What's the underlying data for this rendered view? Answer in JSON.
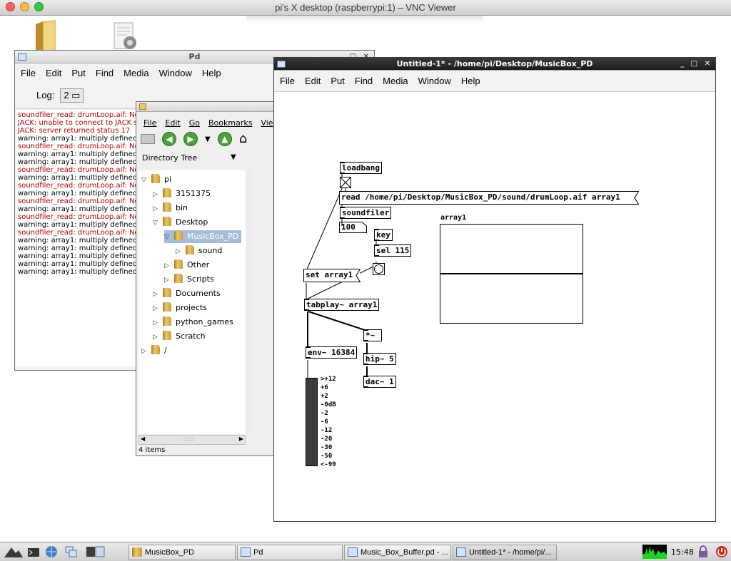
{
  "vnc": {
    "title": "pi's X desktop (raspberrypi:1) – VNC Viewer"
  },
  "pd_main": {
    "title": "Pd",
    "menu": [
      "File",
      "Edit",
      "Put",
      "Find",
      "Media",
      "Window",
      "Help"
    ],
    "log_label": "Log:",
    "log_level": "2",
    "log_lines": [
      {
        "text": "soundfiler_read: drumLoop.aif: No",
        "error": true
      },
      {
        "text": "JACK: unable to connect to JACK s",
        "error": true
      },
      {
        "text": "JACK: server returned status 17",
        "error": true
      },
      {
        "text": "warning: array1: multiply defined",
        "error": false
      },
      {
        "text": "soundfiler_read: drumLoop.aif: No",
        "error": true
      },
      {
        "text": "warning: array1: multiply defined",
        "error": false
      },
      {
        "text": "warning: array1: multiply defined",
        "error": false
      },
      {
        "text": "soundfiler_read: drumLoop.aif: No",
        "error": true
      },
      {
        "text": "warning: array1: multiply defined",
        "error": false
      },
      {
        "text": "soundfiler_read: drumLoop.aif: No",
        "error": true
      },
      {
        "text": "warning: array1: multiply defined",
        "error": false
      },
      {
        "text": "soundfiler_read: drumLoop.aif: No",
        "error": true
      },
      {
        "text": "warning: array1: multiply defined",
        "error": false
      },
      {
        "text": "soundfiler_read: drumLoop.aif: No",
        "error": true
      },
      {
        "text": "warning: array1: multiply defined",
        "error": false
      },
      {
        "text": "soundfiler_read: drumLoop.aif: No",
        "error": true
      },
      {
        "text": "warning: array1: multiply defined",
        "error": false
      },
      {
        "text": "warning: array1: multiply defined",
        "error": false
      },
      {
        "text": "warning: array1: multiply defined",
        "error": false
      },
      {
        "text": "warning: array1: multiply defined",
        "error": false
      },
      {
        "text": "warning: array1: multiply defined",
        "error": false
      }
    ]
  },
  "file_manager": {
    "menu": [
      "File",
      "Edit",
      "Go",
      "Bookmarks",
      "Vie"
    ],
    "sidepane_label": "Directory Tree",
    "tree": [
      {
        "label": "pi",
        "level": 0,
        "expanded": true
      },
      {
        "label": "3151375",
        "level": 1,
        "expanded": false
      },
      {
        "label": "bin",
        "level": 1,
        "expanded": false
      },
      {
        "label": "Desktop",
        "level": 1,
        "expanded": true
      },
      {
        "label": "MusicBox_PD",
        "level": 2,
        "expanded": true,
        "selected": true
      },
      {
        "label": "sound",
        "level": 3,
        "expanded": false
      },
      {
        "label": "Other",
        "level": 2,
        "expanded": false
      },
      {
        "label": "Scripts",
        "level": 2,
        "expanded": false
      },
      {
        "label": "Documents",
        "level": 1,
        "expanded": false
      },
      {
        "label": "projects",
        "level": 1,
        "expanded": false
      },
      {
        "label": "python_games",
        "level": 1,
        "expanded": false
      },
      {
        "label": "Scratch",
        "level": 1,
        "expanded": false
      },
      {
        "label": "/",
        "level": 0,
        "expanded": false
      }
    ],
    "status": "4 items"
  },
  "patch": {
    "title": "Untitled-1* - /home/pi/Desktop/MusicBox_PD",
    "menu": [
      "File",
      "Edit",
      "Put",
      "Find",
      "Media",
      "Window",
      "Help"
    ],
    "objects": {
      "loadbang": "loadbang",
      "read_msg": "read /home/pi/Desktop/MusicBox_PD/sound/drumLoop.aif array1",
      "soundfiler": "soundfiler",
      "number": "100",
      "key": "key",
      "sel": "sel 115",
      "set_msg": "set array1",
      "tabplay": "tabplay~ array1",
      "mult": "*~",
      "env": "env~ 16384",
      "hip": "hip~ 5",
      "dac": "dac~ 1"
    },
    "array_name": "array1",
    "vu_labels": [
      ">+12",
      "+6",
      "+2",
      "-0dB",
      "-2",
      "-6",
      "-12",
      "-20",
      "-30",
      "-50",
      "<-99"
    ]
  },
  "taskbar": {
    "tasks": [
      {
        "label": "MusicBox_PD",
        "icon": "folder-icon"
      },
      {
        "label": "Pd",
        "icon": "window-icon"
      },
      {
        "label": "Music_Box_Buffer.pd - ...",
        "icon": "window-icon"
      },
      {
        "label": "Untitled-1* - /home/pi/...",
        "icon": "window-icon"
      }
    ],
    "clock": "15:48"
  }
}
